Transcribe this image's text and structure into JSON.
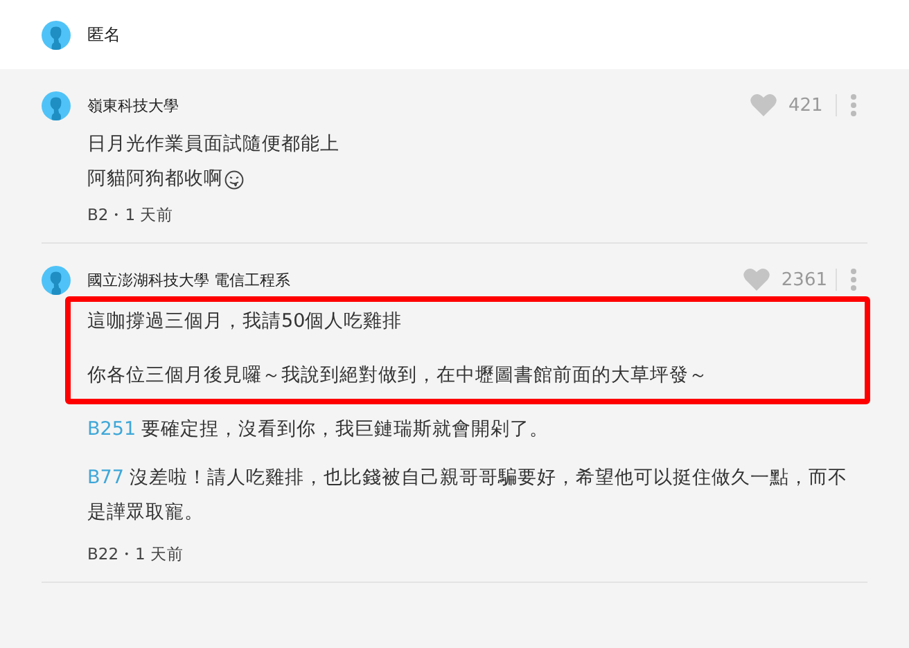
{
  "header": {
    "name": "匿名"
  },
  "comments": [
    {
      "author": "嶺東科技大學",
      "likes": "421",
      "body": [
        {
          "kind": "plain",
          "lines": [
            {
              "text": "日月光作業員面試隨便都能上",
              "emoji": false
            },
            {
              "text": "阿貓阿狗都收啊",
              "emoji": true
            }
          ]
        }
      ],
      "meta": "B2・1 天前"
    },
    {
      "author": "國立澎湖科技大學 電信工程系",
      "likes": "2361",
      "body": [
        {
          "kind": "highlight",
          "lines": [
            {
              "text": "這咖撐過三個月，我請50個人吃雞排",
              "emoji": false
            },
            {
              "text": "你各位三個月後見囉～我說到絕對做到，在中壢圖書館前面的大草坪發～",
              "emoji": false
            }
          ]
        },
        {
          "kind": "reply",
          "ref": "B251",
          "text": "要確定捏，沒看到你，我巨鏈瑞斯就會開剁了。"
        },
        {
          "kind": "reply",
          "ref": "B77",
          "text": "沒差啦！請人吃雞排，也比錢被自己親哥哥騙要好，希望他可以挺住做久一點，而不是譁眾取寵。"
        }
      ],
      "meta": "B22・1 天前"
    }
  ]
}
